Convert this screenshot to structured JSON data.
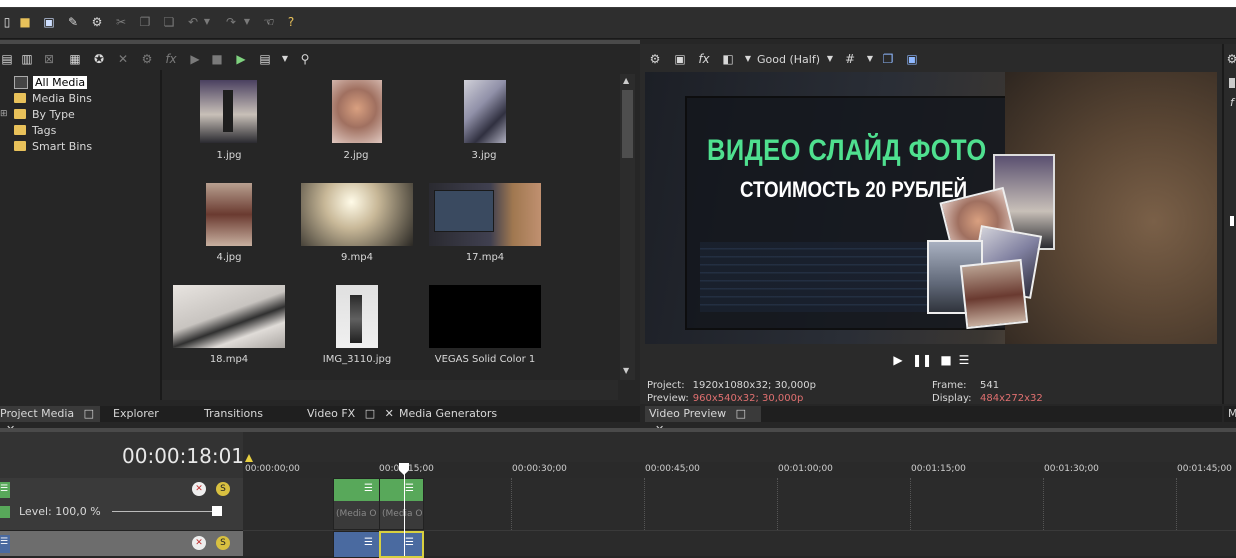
{
  "explorer": {
    "tree": [
      "All Media",
      "Media Bins",
      "By Type",
      "Tags",
      "Smart Bins"
    ]
  },
  "media": [
    {
      "name": "1.jpg"
    },
    {
      "name": "2.jpg"
    },
    {
      "name": "3.jpg"
    },
    {
      "name": "4.jpg"
    },
    {
      "name": "9.mp4"
    },
    {
      "name": "17.mp4"
    },
    {
      "name": "18.mp4"
    },
    {
      "name": "IMG_3110.jpg"
    },
    {
      "name": "VEGAS Solid Color 1"
    }
  ],
  "tabs": {
    "left": [
      "Project Media",
      "Explorer",
      "Transitions",
      "Video FX",
      "Media Generators"
    ],
    "preview": "Video Preview"
  },
  "preview_toolbar": {
    "fx": "fx",
    "quality": "Good (Half)"
  },
  "preview_frame": {
    "line1": "ВИДЕО СЛАЙД ФОТО",
    "line2": "СТОИМОСТЬ 20 РУБЛЕЙ"
  },
  "info": {
    "project_label": "Project:",
    "project_value": "1920x1080x32; 30,000p",
    "preview_label": "Preview:",
    "preview_value": "960x540x32; 30,000p",
    "frame_label": "Frame:",
    "frame_value": "541",
    "display_label": "Display:",
    "display_value": "484x272x32"
  },
  "timeline": {
    "timecode": "00:00:18:01",
    "ruler": [
      "00:00:00;00",
      "00:00:15;00",
      "00:00:30;00",
      "00:00:45;00",
      "00:01:00;00",
      "00:01:15;00",
      "00:01:30;00",
      "00:01:45;00"
    ],
    "track1_level": "Level: 100,0 %",
    "clip_label": "(Media O"
  },
  "right_panel": {
    "fx": "f",
    "tab": "M"
  },
  "colors": {
    "title_green": "#4fe08f",
    "accent_red": "#e07070",
    "clip_green": "#58a85a",
    "clip_blue": "#4a6aa0"
  }
}
